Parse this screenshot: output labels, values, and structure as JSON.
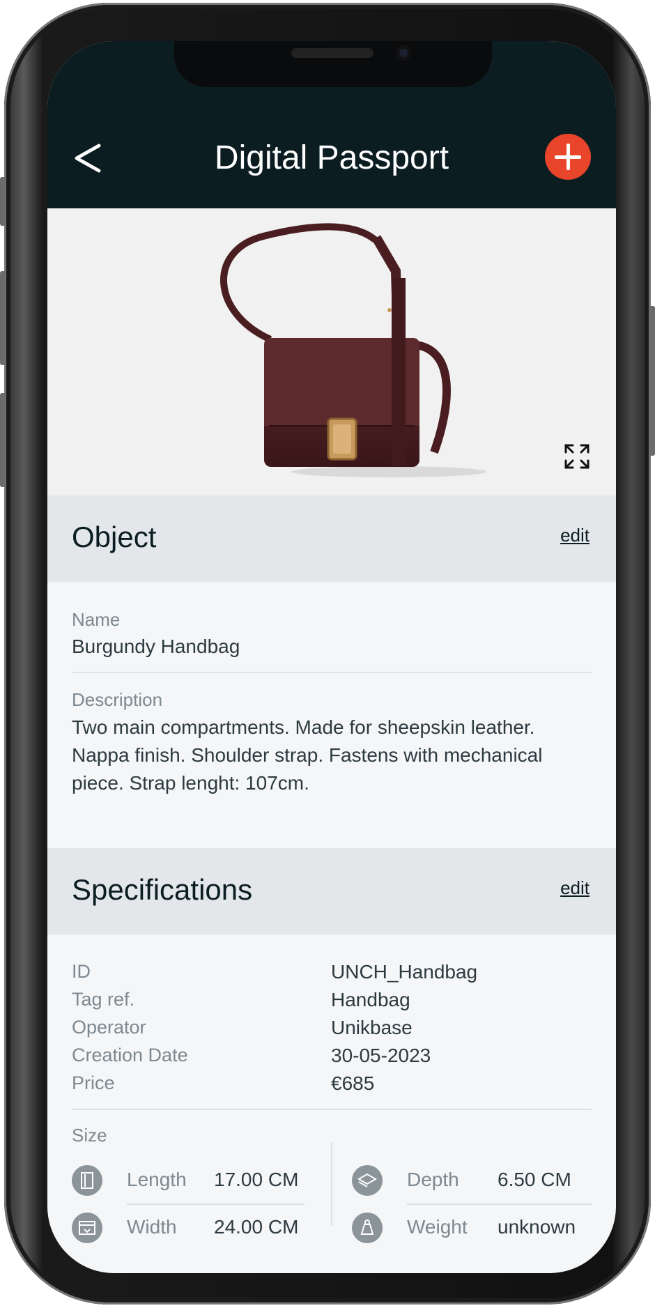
{
  "header": {
    "back_icon": "chevron-left-icon",
    "title": "Digital Passport",
    "add_icon": "plus-icon"
  },
  "hero": {
    "image": "burgundy-handbag-photo",
    "expand_icon": "expand-icon"
  },
  "object": {
    "title": "Object",
    "edit": "edit",
    "name_label": "Name",
    "name_value": "Burgundy Handbag",
    "description_label": "Description",
    "description_value": "Two main compartments. Made for sheepskin leather. Nappa finish. Shoulder strap. Fastens with mechanical piece. Strap lenght: 107cm."
  },
  "specifications": {
    "title": "Specifications",
    "edit": "edit",
    "rows": [
      {
        "label": "ID",
        "value": "UNCH_Handbag"
      },
      {
        "label": "Tag ref.",
        "value": "Handbag"
      },
      {
        "label": "Operator",
        "value": "Unikbase"
      },
      {
        "label": "Creation Date",
        "value": "30-05-2023"
      },
      {
        "label": "Price",
        "value": "€685"
      }
    ],
    "size_label": "Size",
    "size": [
      {
        "label": "Length",
        "value": "17.00 CM",
        "icon": "length-icon"
      },
      {
        "label": "Depth",
        "value": "6.50 CM",
        "icon": "depth-icon"
      },
      {
        "label": "Width",
        "value": "24.00 CM",
        "icon": "width-icon"
      },
      {
        "label": "Weight",
        "value": "unknown",
        "icon": "weight-icon"
      }
    ]
  },
  "colors": {
    "header_bg": "#0c1d22",
    "accent": "#e8452a",
    "section_bg": "#e3e7e9",
    "body_bg": "#f5f6f7"
  }
}
